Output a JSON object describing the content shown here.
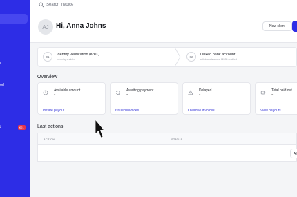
{
  "sidebar": {
    "items": [
      {
        "label": "ns"
      },
      {
        "label": "thod"
      },
      {
        "label": "nd",
        "badge": "€21"
      }
    ],
    "accent": "#2d2de6"
  },
  "search": {
    "placeholder": "Search invoice"
  },
  "header": {
    "avatar_initials": "AJ",
    "greeting": "Hi, Anna Johns",
    "new_client_label": "New client"
  },
  "steps": [
    {
      "number": "01",
      "title": "Identity verification (KYC)",
      "subtitle": "invoicing enabled"
    },
    {
      "number": "02",
      "title": "Linked bank account",
      "subtitle": "withdrawals above €2435 enabled"
    }
  ],
  "overview": {
    "title": "Overview",
    "cards": [
      {
        "icon": "clock-icon",
        "label": "Available amount",
        "value": "-",
        "link": "Initiate payout"
      },
      {
        "icon": "refresh-icon",
        "label": "Awaiting payment",
        "value": "-",
        "link": "Issued invoices"
      },
      {
        "icon": "alert-icon",
        "label": "Delayed",
        "value": "-",
        "link": "Overdue invoices"
      },
      {
        "icon": "payout-icon",
        "label": "Total paid out",
        "value": "-",
        "link": "View payouts"
      }
    ]
  },
  "last_actions": {
    "title": "Last actions",
    "columns": [
      "ACTION",
      "STATUS"
    ],
    "all_button": "All"
  },
  "colors": {
    "accent": "#2d2de6",
    "link": "#3535d8",
    "badge": "#e5344c"
  }
}
